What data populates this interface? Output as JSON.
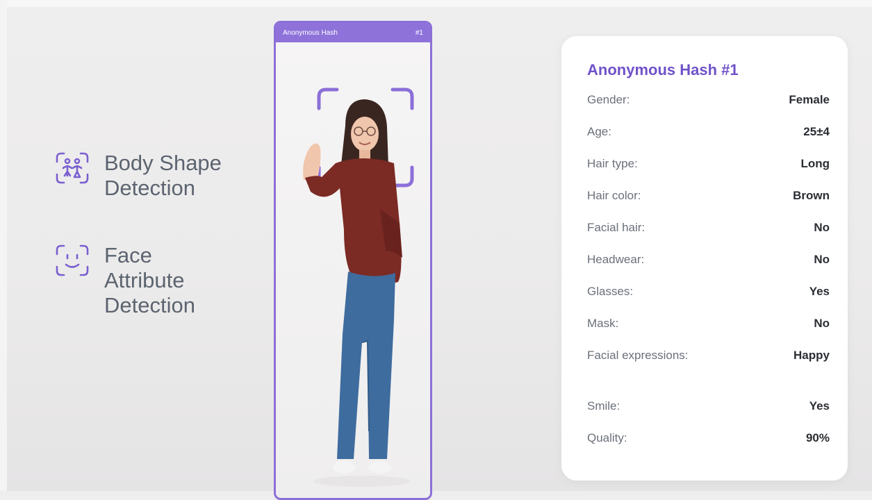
{
  "features": [
    {
      "icon": "body-shape-icon",
      "label_line1": "Body Shape",
      "label_line2": "Detection"
    },
    {
      "icon": "face-icon",
      "label_line1": "Face",
      "label_line2": "Attribute",
      "label_line3": "Detection"
    }
  ],
  "scan_card": {
    "title": "Anonymous Hash",
    "number": "#1",
    "accent": "#8e72da"
  },
  "info_card": {
    "title": "Anonymous Hash #1",
    "rows": [
      {
        "key": "Gender:",
        "value": "Female"
      },
      {
        "key": "Age:",
        "value": "25±4"
      },
      {
        "key": "Hair type:",
        "value": "Long"
      },
      {
        "key": "Hair color:",
        "value": "Brown"
      },
      {
        "key": "Facial hair:",
        "value": "No"
      },
      {
        "key": "Headwear:",
        "value": "No"
      },
      {
        "key": "Glasses:",
        "value": "Yes"
      },
      {
        "key": "Mask:",
        "value": "No"
      },
      {
        "key": "Facial expressions:",
        "value": "Happy"
      },
      {
        "key": "Smile:",
        "value": "Yes"
      },
      {
        "key": "Quality:",
        "value": "90%"
      }
    ]
  },
  "colors": {
    "accent": "#8b6fd8",
    "title": "#6f52c9"
  }
}
